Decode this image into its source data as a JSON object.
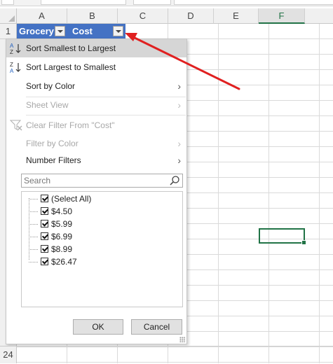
{
  "columns": [
    "A",
    "B",
    "C",
    "D",
    "E",
    "F"
  ],
  "row_headers": {
    "first": "1",
    "last": "24"
  },
  "header_cells": {
    "a": "Grocery",
    "b": "Cost"
  },
  "menu": {
    "sort_asc": "Sort Smallest to Largest",
    "sort_desc": "Sort Largest to Smallest",
    "sort_by_color": "Sort by Color",
    "sheet_view": "Sheet View",
    "clear_filter": "Clear Filter From \"Cost\"",
    "filter_by_color": "Filter by Color",
    "number_filters": "Number Filters"
  },
  "search": {
    "placeholder": "Search"
  },
  "filter_items": [
    "(Select All)",
    "$4.50",
    "$5.99",
    "$6.99",
    "$8.99",
    "$26.47"
  ],
  "buttons": {
    "ok": "OK",
    "cancel": "Cancel"
  },
  "colors": {
    "header_fill": "#4472c4",
    "excel_green": "#217346",
    "annotation_arrow": "#e02020"
  }
}
